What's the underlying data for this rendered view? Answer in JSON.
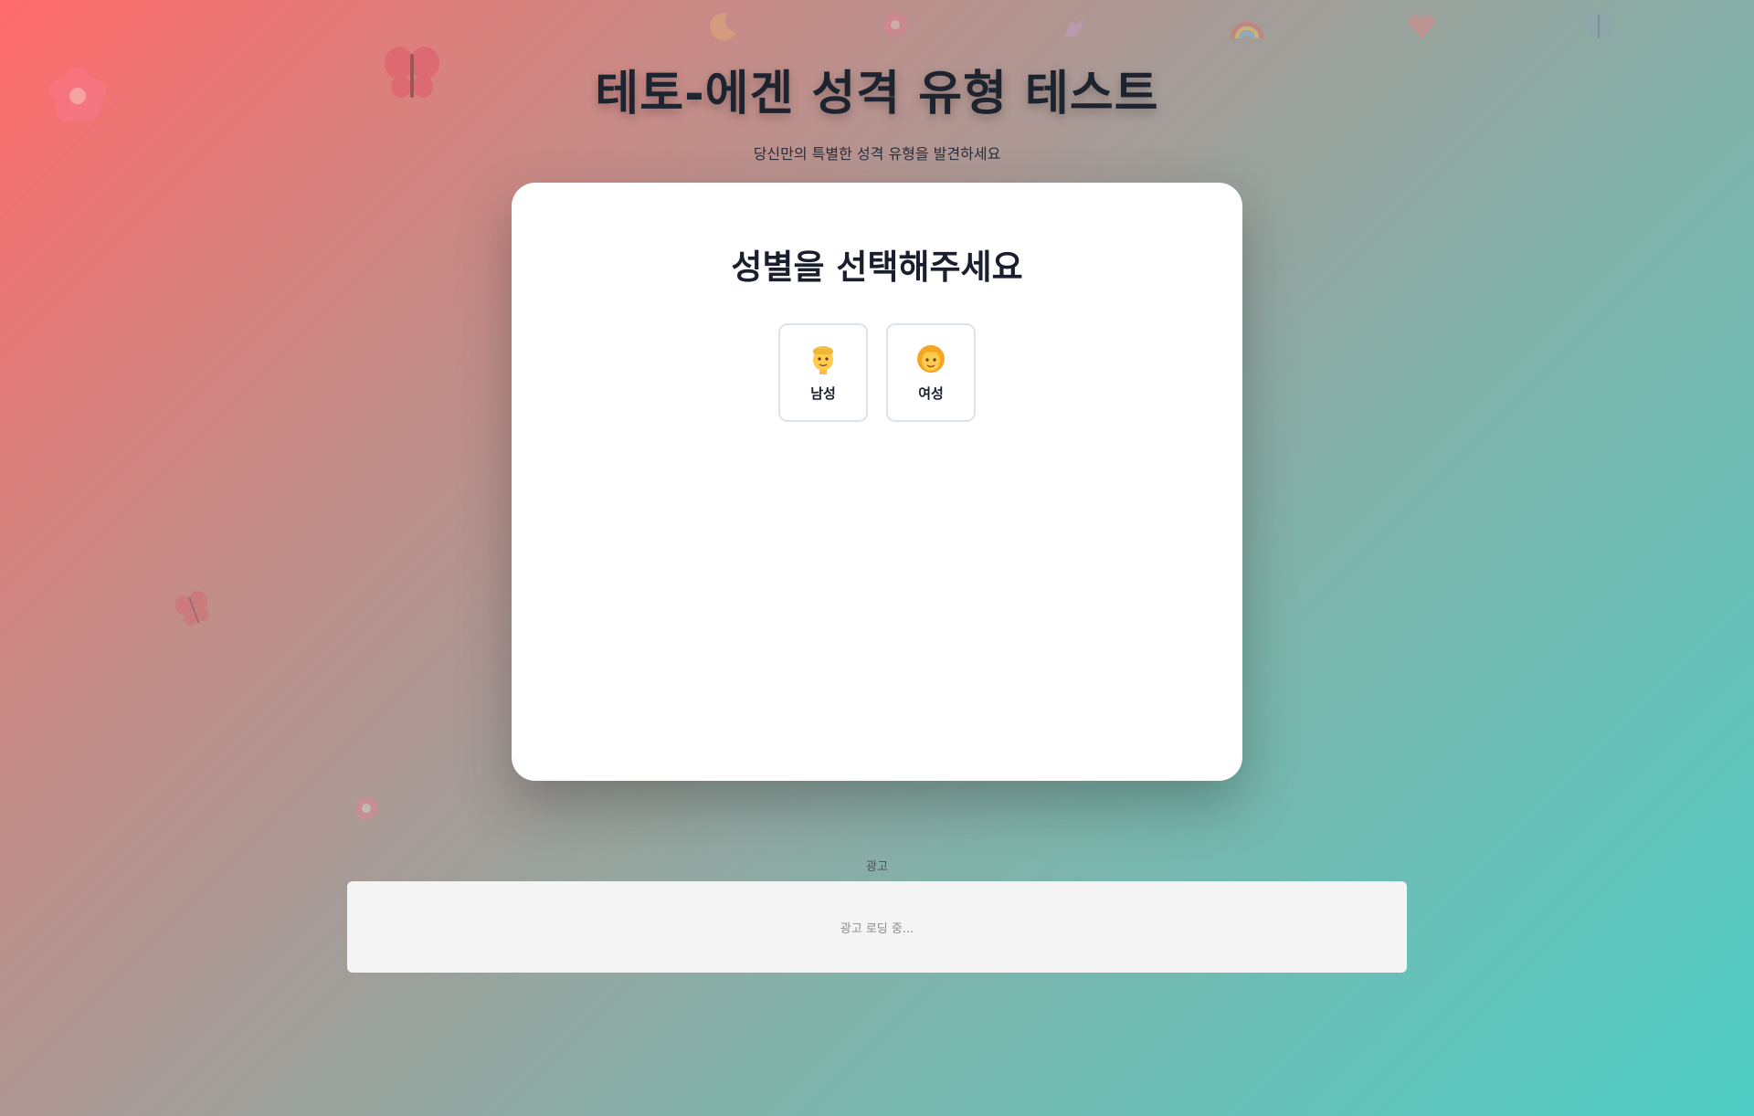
{
  "header": {
    "title": "테토-에겐 성격 유형 테스트",
    "subtitle": "당신만의 특별한 성격 유형을 발견하세요"
  },
  "card": {
    "title": "성별을 선택해주세요",
    "options": [
      {
        "label": "남성",
        "icon": "man-face-icon"
      },
      {
        "label": "여성",
        "icon": "woman-face-icon"
      }
    ]
  },
  "ad": {
    "label": "광고",
    "loading_text": "광고 로딩 중..."
  },
  "colors": {
    "gradient_start": "#ff6b6b",
    "gradient_end": "#4ecdc4",
    "card_bg": "#ffffff",
    "text_dark": "#1a1f2e"
  },
  "decorations": [
    "butterfly-icon",
    "flower-icon",
    "rainbow-icon",
    "heart-icon",
    "unicorn-icon",
    "moon-icon"
  ]
}
